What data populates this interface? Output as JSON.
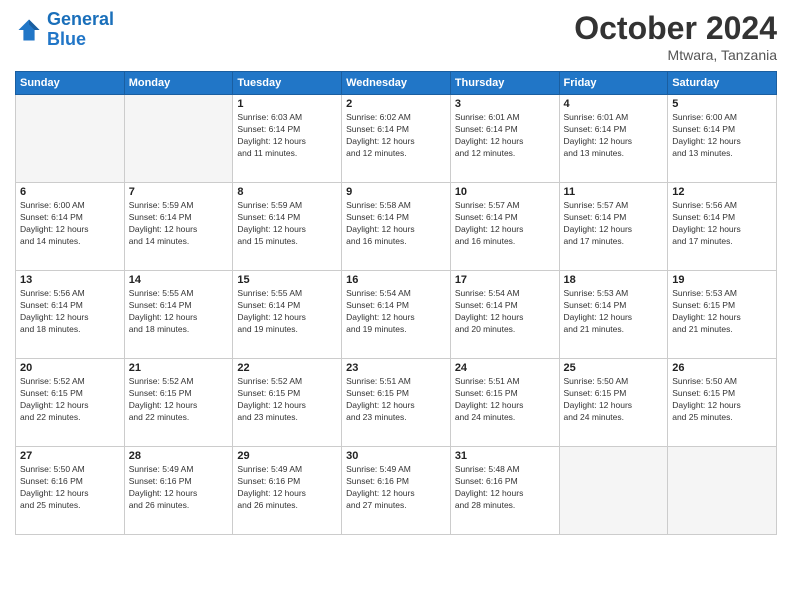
{
  "header": {
    "logo_line1": "General",
    "logo_line2": "Blue",
    "month": "October 2024",
    "location": "Mtwara, Tanzania"
  },
  "weekdays": [
    "Sunday",
    "Monday",
    "Tuesday",
    "Wednesday",
    "Thursday",
    "Friday",
    "Saturday"
  ],
  "weeks": [
    [
      {
        "day": "",
        "info": ""
      },
      {
        "day": "",
        "info": ""
      },
      {
        "day": "1",
        "info": "Sunrise: 6:03 AM\nSunset: 6:14 PM\nDaylight: 12 hours\nand 11 minutes."
      },
      {
        "day": "2",
        "info": "Sunrise: 6:02 AM\nSunset: 6:14 PM\nDaylight: 12 hours\nand 12 minutes."
      },
      {
        "day": "3",
        "info": "Sunrise: 6:01 AM\nSunset: 6:14 PM\nDaylight: 12 hours\nand 12 minutes."
      },
      {
        "day": "4",
        "info": "Sunrise: 6:01 AM\nSunset: 6:14 PM\nDaylight: 12 hours\nand 13 minutes."
      },
      {
        "day": "5",
        "info": "Sunrise: 6:00 AM\nSunset: 6:14 PM\nDaylight: 12 hours\nand 13 minutes."
      }
    ],
    [
      {
        "day": "6",
        "info": "Sunrise: 6:00 AM\nSunset: 6:14 PM\nDaylight: 12 hours\nand 14 minutes."
      },
      {
        "day": "7",
        "info": "Sunrise: 5:59 AM\nSunset: 6:14 PM\nDaylight: 12 hours\nand 14 minutes."
      },
      {
        "day": "8",
        "info": "Sunrise: 5:59 AM\nSunset: 6:14 PM\nDaylight: 12 hours\nand 15 minutes."
      },
      {
        "day": "9",
        "info": "Sunrise: 5:58 AM\nSunset: 6:14 PM\nDaylight: 12 hours\nand 16 minutes."
      },
      {
        "day": "10",
        "info": "Sunrise: 5:57 AM\nSunset: 6:14 PM\nDaylight: 12 hours\nand 16 minutes."
      },
      {
        "day": "11",
        "info": "Sunrise: 5:57 AM\nSunset: 6:14 PM\nDaylight: 12 hours\nand 17 minutes."
      },
      {
        "day": "12",
        "info": "Sunrise: 5:56 AM\nSunset: 6:14 PM\nDaylight: 12 hours\nand 17 minutes."
      }
    ],
    [
      {
        "day": "13",
        "info": "Sunrise: 5:56 AM\nSunset: 6:14 PM\nDaylight: 12 hours\nand 18 minutes."
      },
      {
        "day": "14",
        "info": "Sunrise: 5:55 AM\nSunset: 6:14 PM\nDaylight: 12 hours\nand 18 minutes."
      },
      {
        "day": "15",
        "info": "Sunrise: 5:55 AM\nSunset: 6:14 PM\nDaylight: 12 hours\nand 19 minutes."
      },
      {
        "day": "16",
        "info": "Sunrise: 5:54 AM\nSunset: 6:14 PM\nDaylight: 12 hours\nand 19 minutes."
      },
      {
        "day": "17",
        "info": "Sunrise: 5:54 AM\nSunset: 6:14 PM\nDaylight: 12 hours\nand 20 minutes."
      },
      {
        "day": "18",
        "info": "Sunrise: 5:53 AM\nSunset: 6:14 PM\nDaylight: 12 hours\nand 21 minutes."
      },
      {
        "day": "19",
        "info": "Sunrise: 5:53 AM\nSunset: 6:15 PM\nDaylight: 12 hours\nand 21 minutes."
      }
    ],
    [
      {
        "day": "20",
        "info": "Sunrise: 5:52 AM\nSunset: 6:15 PM\nDaylight: 12 hours\nand 22 minutes."
      },
      {
        "day": "21",
        "info": "Sunrise: 5:52 AM\nSunset: 6:15 PM\nDaylight: 12 hours\nand 22 minutes."
      },
      {
        "day": "22",
        "info": "Sunrise: 5:52 AM\nSunset: 6:15 PM\nDaylight: 12 hours\nand 23 minutes."
      },
      {
        "day": "23",
        "info": "Sunrise: 5:51 AM\nSunset: 6:15 PM\nDaylight: 12 hours\nand 23 minutes."
      },
      {
        "day": "24",
        "info": "Sunrise: 5:51 AM\nSunset: 6:15 PM\nDaylight: 12 hours\nand 24 minutes."
      },
      {
        "day": "25",
        "info": "Sunrise: 5:50 AM\nSunset: 6:15 PM\nDaylight: 12 hours\nand 24 minutes."
      },
      {
        "day": "26",
        "info": "Sunrise: 5:50 AM\nSunset: 6:15 PM\nDaylight: 12 hours\nand 25 minutes."
      }
    ],
    [
      {
        "day": "27",
        "info": "Sunrise: 5:50 AM\nSunset: 6:16 PM\nDaylight: 12 hours\nand 25 minutes."
      },
      {
        "day": "28",
        "info": "Sunrise: 5:49 AM\nSunset: 6:16 PM\nDaylight: 12 hours\nand 26 minutes."
      },
      {
        "day": "29",
        "info": "Sunrise: 5:49 AM\nSunset: 6:16 PM\nDaylight: 12 hours\nand 26 minutes."
      },
      {
        "day": "30",
        "info": "Sunrise: 5:49 AM\nSunset: 6:16 PM\nDaylight: 12 hours\nand 27 minutes."
      },
      {
        "day": "31",
        "info": "Sunrise: 5:48 AM\nSunset: 6:16 PM\nDaylight: 12 hours\nand 28 minutes."
      },
      {
        "day": "",
        "info": ""
      },
      {
        "day": "",
        "info": ""
      }
    ]
  ]
}
